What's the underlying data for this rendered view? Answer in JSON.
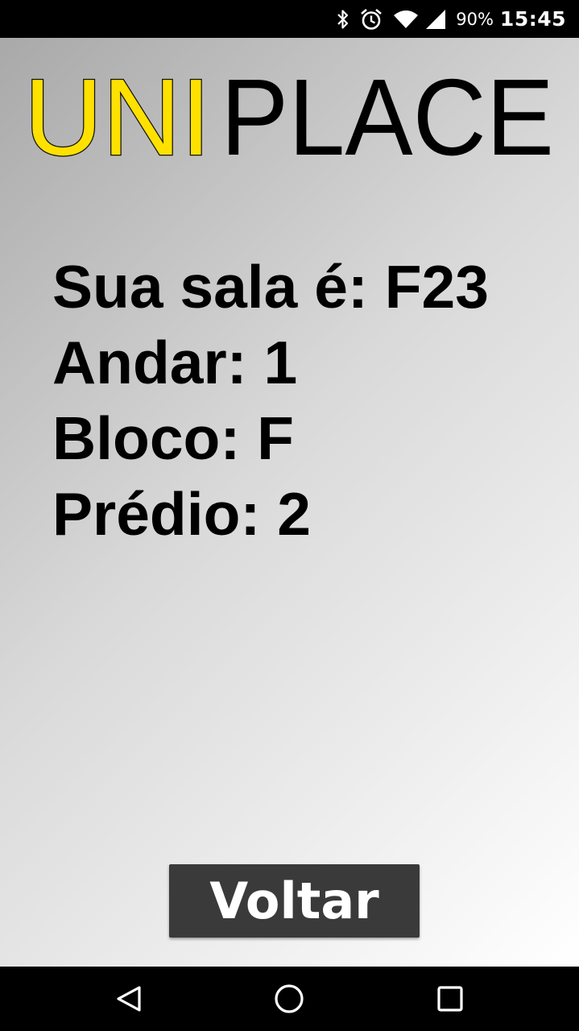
{
  "status_bar": {
    "battery_text": "90%",
    "time": "15:45",
    "icons": [
      "bluetooth-icon",
      "alarm-icon",
      "wifi-icon",
      "cell-signal-icon"
    ]
  },
  "logo": {
    "part1": "UNI",
    "part2": "PLACE",
    "part1_color": "#ffe100",
    "part2_color": "#000000"
  },
  "info": {
    "room": "Sua sala é: F23",
    "floor": "Andar: 1",
    "block": "Bloco: F",
    "building": "Prédio: 2"
  },
  "back_button": {
    "label": "Voltar"
  },
  "nav_bar": {
    "icons": [
      "back-icon",
      "home-icon",
      "recents-icon"
    ]
  },
  "colors": {
    "gradient_start": "#a9a9a9",
    "gradient_end": "#ffffff",
    "button_bg": "#3a3a3a"
  }
}
